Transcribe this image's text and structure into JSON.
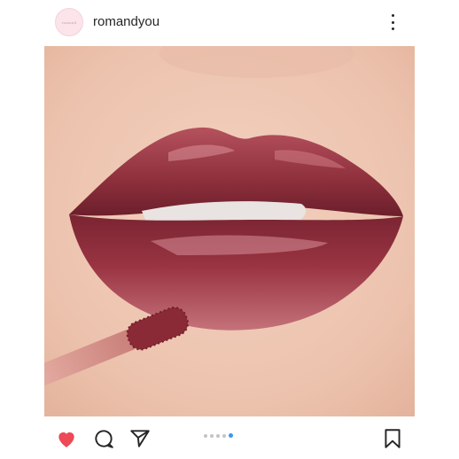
{
  "post": {
    "username": "romandyou",
    "avatar_text": "romand"
  },
  "icons": {
    "more": "more-vertical-icon",
    "like": "heart-icon",
    "comment": "comment-icon",
    "share": "paper-plane-icon",
    "save": "bookmark-icon"
  },
  "carousel": {
    "total": 5,
    "current": 5
  },
  "colors": {
    "like": "#ed4956",
    "indicator_active": "#3897f0",
    "indicator_inactive": "#c4c4c4"
  }
}
